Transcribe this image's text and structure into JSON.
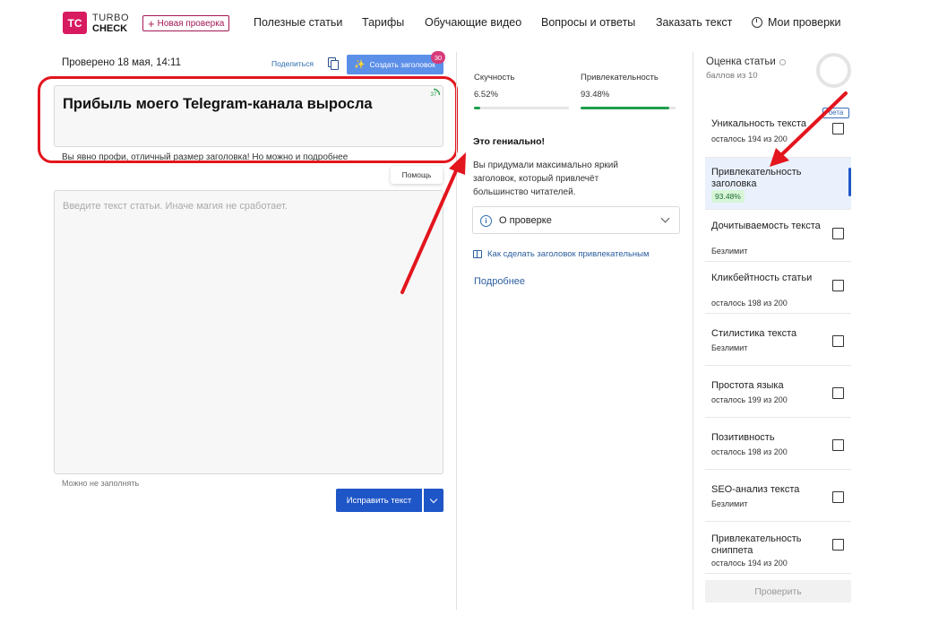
{
  "header": {
    "logo_mark": "TC",
    "logo_line1": "TURBO",
    "logo_line2": "CHECK",
    "new_check_label": "Новая проверка",
    "nav": [
      "Полезные статьи",
      "Тарифы",
      "Обучающие видео",
      "Вопросы и ответы",
      "Заказать текст"
    ],
    "my_checks_label": "Мои проверки"
  },
  "editor": {
    "checked_date": "Проверено 18 мая, 14:11",
    "share_label": "Поделиться",
    "create_headline_label": "Создать заголовок",
    "create_headline_badge": "30",
    "headline_text": "Прибыль моего Telegram-канала выросла",
    "headline_counter": "37",
    "headline_hint": "Вы явно профи, отличный размер заголовка! Но можно и подробнее",
    "help_label": "Помощь",
    "article_placeholder": "Введите текст статьи. Иначе магия не сработает.",
    "optional_label": "Можно не заполнять",
    "fix_button_label": "Исправить текст"
  },
  "analysis": {
    "metrics": [
      {
        "label": "Скучность",
        "value": "6.52%",
        "fill": 0.0652
      },
      {
        "label": "Привлекательность",
        "value": "93.48%",
        "fill": 0.9348
      }
    ],
    "verdict_title": "Это гениально!",
    "verdict_text": "Вы придумали максимально яркий заголовок, который привлечёт большинство читателей.",
    "about_label": "О проверке",
    "howto_label": "Как сделать заголовок привлекательным",
    "more_label": "Подробнее"
  },
  "score": {
    "title": "Оценка статьи",
    "subtitle": "баллов из 10",
    "beta_label": "бета",
    "criteria": [
      {
        "name": "Уникальность текста",
        "meta": "осталось 194 из 200",
        "active": false
      },
      {
        "name": "Привлекательность заголовка",
        "meta": "",
        "badge": "93.48%",
        "active": true
      },
      {
        "name": "Дочитываемость текста",
        "meta": "Безлимит",
        "active": false
      },
      {
        "name": "Кликбейтность статьи",
        "meta": "осталось 198 из 200",
        "active": false
      },
      {
        "name": "Стилистика текста",
        "meta": "Безлимит",
        "active": false
      },
      {
        "name": "Простота языка",
        "meta": "осталось 199 из 200",
        "active": false
      },
      {
        "name": "Позитивность",
        "meta": "осталось 198 из 200",
        "active": false
      },
      {
        "name": "SEO-анализ текста",
        "meta": "Безлимит",
        "active": false
      },
      {
        "name": "Привлекательность сниппета",
        "meta": "осталось 194 из 200",
        "active": false
      }
    ],
    "verify_label": "Проверить"
  },
  "colors": {
    "brand": "#d81b60",
    "primary_blue": "#1f56c7",
    "progress_green": "#1e9e4e",
    "annotation_red": "#e3151d"
  }
}
